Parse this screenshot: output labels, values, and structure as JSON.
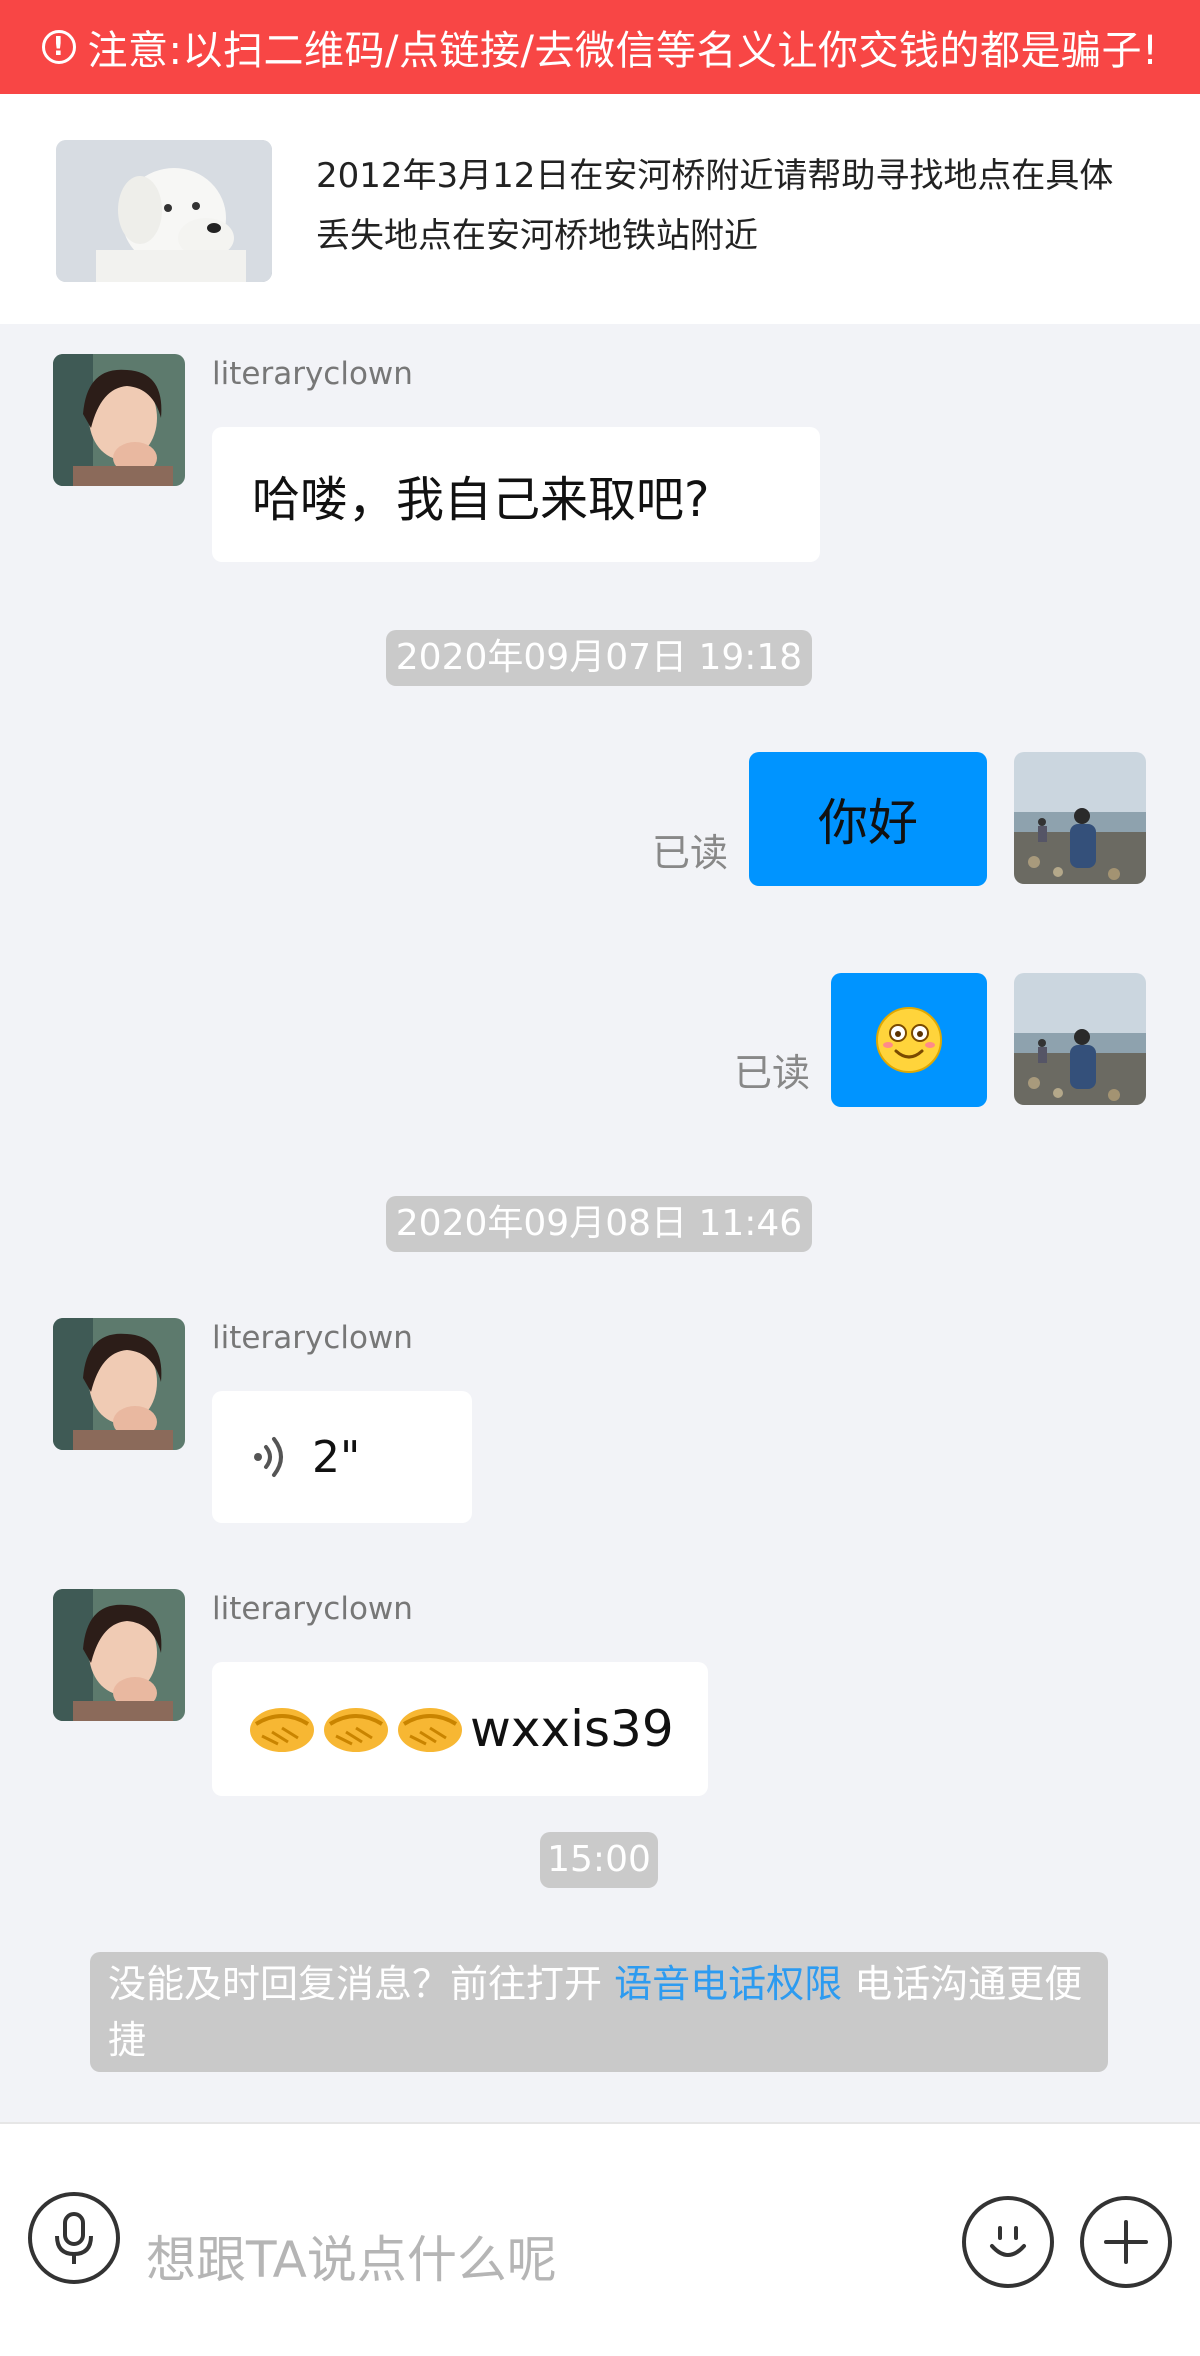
{
  "banner": {
    "icon": "exclamation-circle-icon",
    "text": "注意:以扫二维码/点链接/去微信等名义让你交钱的都是骗子!"
  },
  "post": {
    "image": "white-dog-photo",
    "description": "2012年3月12日在安河桥附近请帮助寻找地点在具体丢失地点在安河桥地铁站附近"
  },
  "messages": {
    "m1": {
      "sender": "literaryclown",
      "text": "哈喽，我自己来取吧?"
    },
    "t1": "2020年09月07日 19:18",
    "m2": {
      "text": "你好",
      "status": "已读"
    },
    "m3": {
      "emoji": "smiling-face-emoji",
      "status": "已读"
    },
    "t2": "2020年09月08日 11:46",
    "m4": {
      "sender": "literaryclown",
      "voice_duration": "2\""
    },
    "m5": {
      "sender": "literaryclown",
      "emoji": "handshake-emoji",
      "text": "wxxis39"
    },
    "t3": "15:00"
  },
  "notice": {
    "prefix": "没能及时回复消息？前往打开 ",
    "link": "语音电话权限",
    "suffix": " 电话沟通更便捷"
  },
  "input": {
    "placeholder": "想跟TA说点什么呢"
  },
  "colors": {
    "banner_bg": "#f84645",
    "bubble_out": "#0094ff",
    "link": "#2d9bf0"
  }
}
